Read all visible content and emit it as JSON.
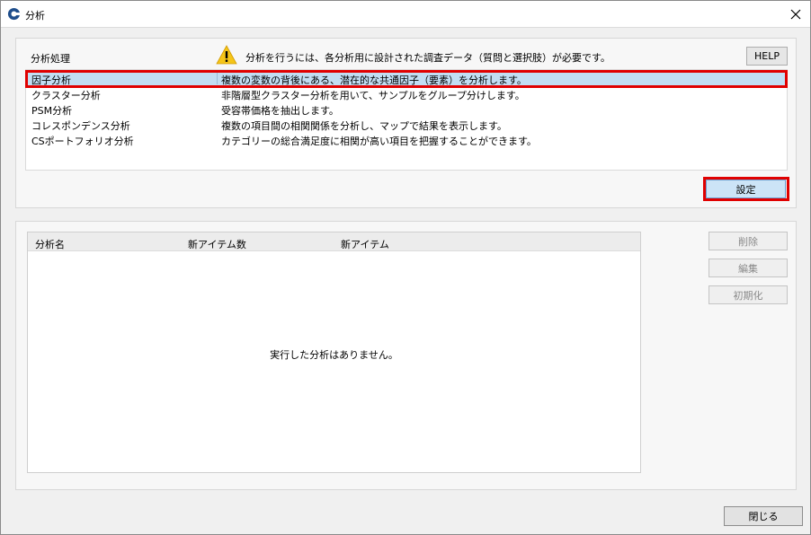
{
  "window": {
    "title": "分析",
    "icon": "analysis-app-icon",
    "close_glyph": "✕"
  },
  "analysis_panel": {
    "label": "分析処理",
    "warning_text": "分析を行うには、各分析用に設計された調査データ（質問と選択肢）が必要です。",
    "warning_icon": "warning-triangle-icon",
    "help_label": "HELP",
    "items": [
      {
        "name": "因子分析",
        "desc": "複数の変数の背後にある、潜在的な共通因子（要素）を分析します。"
      },
      {
        "name": "クラスター分析",
        "desc": "非階層型クラスター分析を用いて、サンプルをグループ分けします。"
      },
      {
        "name": "PSM分析",
        "desc": "受容帯価格を抽出します。"
      },
      {
        "name": "コレスポンデンス分析",
        "desc": "複数の項目間の相関関係を分析し、マップで結果を表示します。"
      },
      {
        "name": "CSポートフォリオ分析",
        "desc": "カテゴリーの総合満足度に相関が高い項目を把握することができます。"
      }
    ],
    "selected_index": 0,
    "settei_label": "設定"
  },
  "results_panel": {
    "columns": [
      "分析名",
      "新アイテム数",
      "新アイテム"
    ],
    "empty_message": "実行した分析はありません。",
    "delete_label": "削除",
    "edit_label": "編集",
    "reset_label": "初期化"
  },
  "footer": {
    "close_label": "閉じる"
  },
  "colors": {
    "selection": "#c2def3",
    "highlight": "#e00000",
    "primary_button": "#cce4f7"
  }
}
